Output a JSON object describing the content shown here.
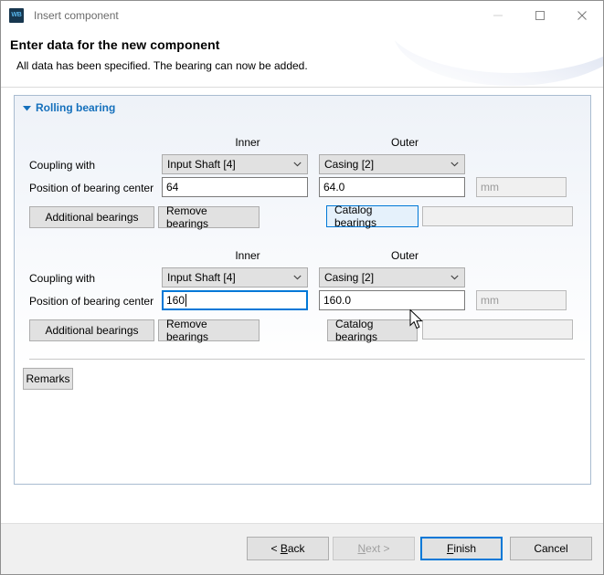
{
  "window": {
    "app_icon_text": "WB",
    "title": "Insert component",
    "controls": {
      "minimize": "minimize-icon",
      "maximize": "maximize-icon",
      "close": "close-icon"
    }
  },
  "header": {
    "title": "Enter data for the new component",
    "subtitle": "All data has been specified. The bearing can now be added."
  },
  "panel": {
    "title": "Rolling bearing",
    "expanded": true,
    "accent_color": "#1570bc",
    "groups": [
      {
        "headers": {
          "inner": "Inner",
          "outer": "Outer"
        },
        "coupling_label": "Coupling with",
        "coupling_inner": "Input Shaft [4]",
        "coupling_outer": "Casing [2]",
        "position_label": "Position of bearing center",
        "position_inner": "64",
        "position_outer": "64.0",
        "unit": "mm",
        "btn_additional": "Additional bearings",
        "btn_remove": "Remove bearings",
        "btn_catalog": "Catalog bearings",
        "catalog_value": "",
        "catalog_hovered": true,
        "position_inner_focused": false
      },
      {
        "headers": {
          "inner": "Inner",
          "outer": "Outer"
        },
        "coupling_label": "Coupling with",
        "coupling_inner": "Input Shaft [4]",
        "coupling_outer": "Casing [2]",
        "position_label": "Position of bearing center",
        "position_inner": "160",
        "position_outer": "160.0",
        "unit": "mm",
        "btn_additional": "Additional bearings",
        "btn_remove": "Remove bearings",
        "btn_catalog": "Catalog bearings",
        "catalog_value": "",
        "catalog_hovered": false,
        "position_inner_focused": true
      }
    ],
    "remarks_label": "Remarks"
  },
  "footer": {
    "back": "< Back",
    "back_accel": "B",
    "next": "Next >",
    "next_accel": "N",
    "next_disabled": true,
    "finish": "Finish",
    "finish_accel": "F",
    "finish_default": true,
    "cancel": "Cancel"
  }
}
